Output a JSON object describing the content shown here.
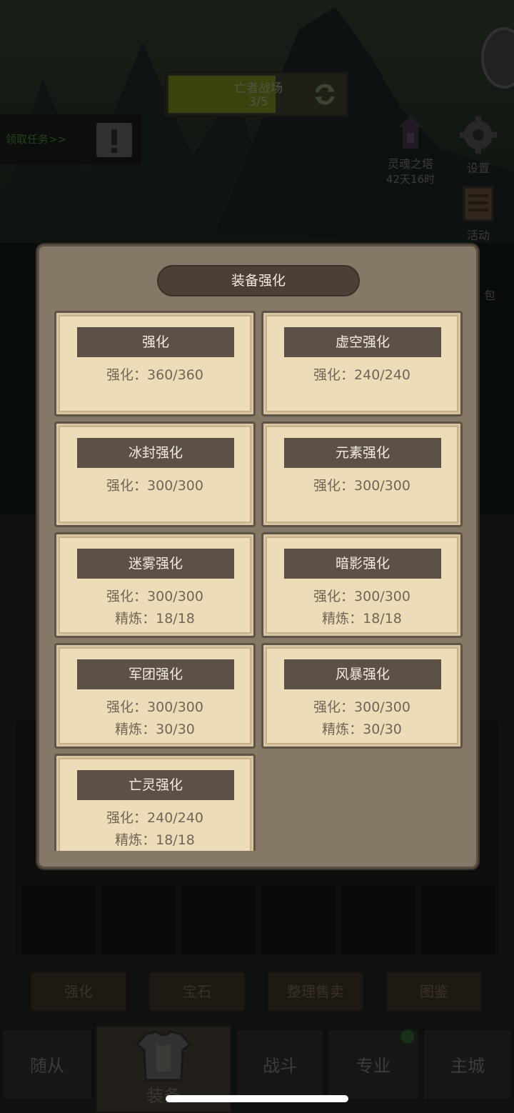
{
  "stage": {
    "name": "亡者战场",
    "progress": "3/5"
  },
  "task": {
    "label": "领取任务>>"
  },
  "soul_tower": {
    "name": "灵魂之塔",
    "countdown": "42天16时"
  },
  "side_menu": [
    {
      "label": "设置"
    },
    {
      "label": "活动"
    },
    {
      "label": "包"
    }
  ],
  "bottom_tools": [
    {
      "label": "强化"
    },
    {
      "label": "宝石"
    },
    {
      "label": "整理售卖"
    },
    {
      "label": "图鉴"
    }
  ],
  "nav": {
    "tabs": [
      {
        "label": "随从"
      },
      {
        "label": "装备"
      },
      {
        "label": "战斗"
      },
      {
        "label": "专业"
      },
      {
        "label": "主城"
      }
    ]
  },
  "modal": {
    "title": "装备强化",
    "cards": [
      {
        "name": "强化",
        "line1": "强化：360/360",
        "line2": ""
      },
      {
        "name": "虚空强化",
        "line1": "强化：240/240",
        "line2": ""
      },
      {
        "name": "冰封强化",
        "line1": "强化：300/300",
        "line2": ""
      },
      {
        "name": "元素强化",
        "line1": "强化：300/300",
        "line2": ""
      },
      {
        "name": "迷雾强化",
        "line1": "强化：300/300",
        "line2": "精炼：18/18"
      },
      {
        "name": "暗影强化",
        "line1": "强化：300/300",
        "line2": "精炼：18/18"
      },
      {
        "name": "军团强化",
        "line1": "强化：300/300",
        "line2": "精炼：30/30"
      },
      {
        "name": "风暴强化",
        "line1": "强化：300/300",
        "line2": "精炼：30/30"
      },
      {
        "name": "亡灵强化",
        "line1": "强化：240/240",
        "line2": "精炼：18/18"
      }
    ]
  },
  "colors": {
    "card_bg": "#ecdcb8",
    "banner": "#5b5147",
    "panel": "#857866"
  },
  "icons": {
    "refresh": "refresh-icon",
    "alert": "alert-icon",
    "settings": "gear-icon",
    "activity": "calendar-icon",
    "armor": "armor-icon"
  }
}
